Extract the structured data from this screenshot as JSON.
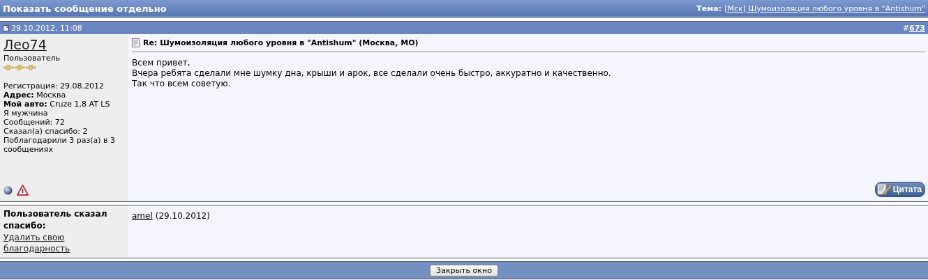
{
  "header": {
    "title": "Показать сообщение отдельно",
    "topic_label": "Тема:",
    "topic_link": "[Мск] Шумоизоляция любого уровня в \"Antishum\""
  },
  "post": {
    "date": "29.10.2012, 11:08",
    "number_prefix": "#",
    "number": "673",
    "author": {
      "name": "Лео74",
      "rank": "Пользователь",
      "stars": 3,
      "details": [
        "Регистрация: 29.08.2012",
        "**Адрес:** Москва",
        "**Мой авто:** Cruze 1,8 AT LS",
        "Я мужчина",
        "Сообщений: 72",
        "Сказал(а) спасибо: 2",
        "Поблагодарили 3 раз(а) в 3 сообщениях"
      ]
    },
    "title": "Re: Шумоизоляция любого уровня в \"Antishum\" (Москва, МО)",
    "body": [
      "Всем привет,",
      "Вчера ребята сделали мне шумку дна, крыши и арок, все сделали очень быстро, аккуратно и качественно.",
      "Так что всем советую."
    ],
    "quote_button": "Цитата"
  },
  "thanks": {
    "label": "Пользователь сказал спасибо:",
    "remove_link": "Удалить свою благодарность",
    "users": [
      {
        "name": "amel",
        "date": "(29.10.2012)"
      }
    ]
  },
  "footer": {
    "close_button": "Закрыть окно"
  }
}
